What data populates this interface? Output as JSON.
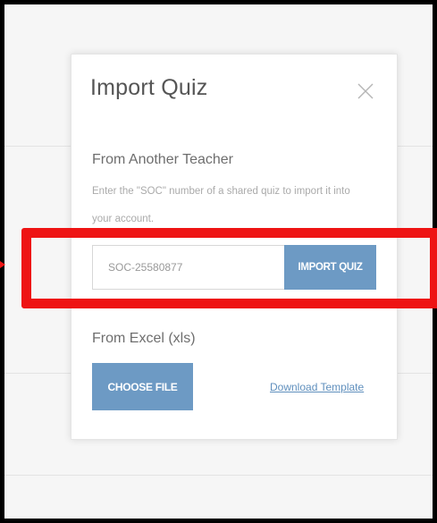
{
  "modal": {
    "title": "Import Quiz",
    "close_icon": "close-icon"
  },
  "another_teacher": {
    "heading": "From Another Teacher",
    "hint": "Enter the \"SOC\" number of a shared quiz to import it into your account.",
    "soc_input_value": "SOC-25580877",
    "import_button_label": "IMPORT QUIZ"
  },
  "excel": {
    "heading": "From Excel (xls)",
    "choose_file_label": "CHOOSE FILE",
    "download_template_label": "Download Template"
  },
  "colors": {
    "accent_button": "#6d9ac4",
    "highlight": "#ee1414",
    "link": "#5f8fbd"
  }
}
